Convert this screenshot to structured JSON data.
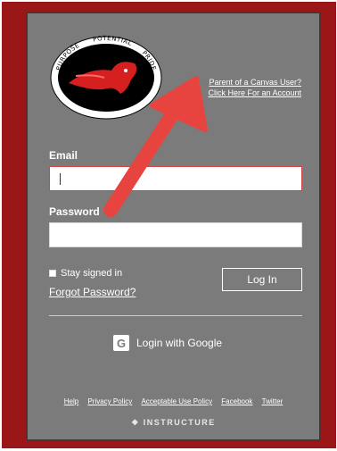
{
  "logo": {
    "arc_text_left": "PURPOSE",
    "arc_text_mid": "POTENTIAL",
    "arc_text_right": "PRIDE",
    "bottom_text": "CEDAR SPRINGS PUBLIC SCHOOLS"
  },
  "parent_link": {
    "line1": "Parent of a Canvas User?",
    "line2": "Click Here For an Account"
  },
  "form": {
    "email_label": "Email",
    "password_label": "Password",
    "email_value": "",
    "password_value": "",
    "stay_signed_in": "Stay signed in",
    "forgot_password": "Forgot Password?",
    "login_button": "Log In"
  },
  "google_login": {
    "label": "Login with Google",
    "icon": "google-icon"
  },
  "footer": {
    "links": [
      "Help",
      "Privacy Policy",
      "Acceptable Use Policy",
      "Facebook",
      "Twitter"
    ],
    "brand": "INSTRUCTURE"
  },
  "colors": {
    "frame": "#9b1616",
    "panel": "#7b7b7b",
    "arrow": "#e8443f"
  }
}
